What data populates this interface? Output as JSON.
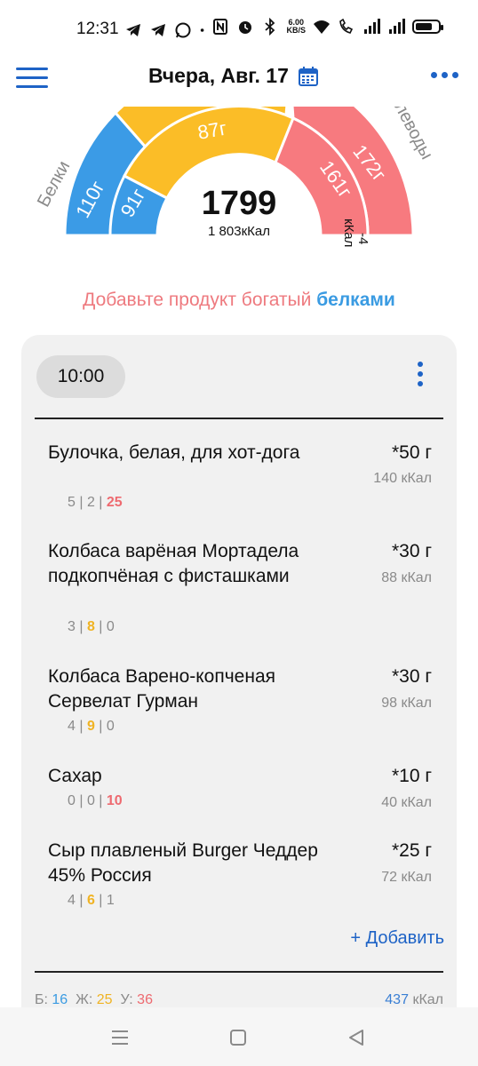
{
  "status_bar": {
    "time": "12:31",
    "net_speed_value": "6.00",
    "net_speed_unit": "KB/S",
    "icons": [
      "telegram-icon",
      "telegram-icon",
      "whatsapp-icon",
      "dot-icon",
      "nfc-icon",
      "alarm-icon",
      "bluetooth-icon",
      "wifi-icon",
      "wifi-call-icon",
      "signal-icon",
      "signal-icon",
      "battery-icon"
    ]
  },
  "header": {
    "title": "Вчера, Авг. 17",
    "menu_icon": "hamburger-icon",
    "calendar_icon": "calendar-icon",
    "more_icon": "more-horizontal-icon"
  },
  "gauge": {
    "total_kcal": "1799",
    "target_text": "1 803кКал",
    "remaining_text": "-4",
    "remaining_unit": "кКал",
    "protein_label": "Белки",
    "carbs_label": "леводы",
    "protein_target": "110г",
    "protein_value": "91г",
    "fat_value": "87г",
    "carbs_target": "172г",
    "carbs_value": "161г",
    "colors": {
      "protein": "#3b9be6",
      "fat": "#fbbd27",
      "carbs": "#f77a7f"
    }
  },
  "tip": {
    "prefix": "Добавьте продукт богатый ",
    "highlight": "белками"
  },
  "meal": {
    "time": "10:00",
    "items": [
      {
        "name": "Булочка, белая, для хот-дога",
        "qty": "*50 г",
        "kcal": "140 кКал",
        "p": "5",
        "f": "2",
        "c": "25"
      },
      {
        "name": "Колбаса варёная Мортадела подкопчёная с фисташками",
        "qty": "*30 г",
        "kcal": "88 кКал",
        "p": "3",
        "f": "8",
        "c": "0"
      },
      {
        "name": "Колбаса Варено-копченая Сервелат Гурман",
        "qty": "*30 г",
        "kcal": "98 кКал",
        "p": "4",
        "f": "9",
        "c": "0"
      },
      {
        "name": "Сахар",
        "qty": "*10 г",
        "kcal": "40 кКал",
        "p": "0",
        "f": "0",
        "c": "10"
      },
      {
        "name": "Сыр плавленый Burger Чеддер 45% Россия",
        "qty": "*25 г",
        "kcal": "72 кКал",
        "p": "4",
        "f": "6",
        "c": "1"
      }
    ],
    "add_label": "+ Добавить",
    "totals": {
      "p_label": "Б:",
      "p": "16",
      "f_label": "Ж:",
      "f": "25",
      "c_label": "У:",
      "c": "36",
      "kcal": "437",
      "kcal_unit": "кКал"
    }
  },
  "nav": {
    "icons": [
      "recents-icon",
      "home-icon",
      "back-icon"
    ]
  }
}
